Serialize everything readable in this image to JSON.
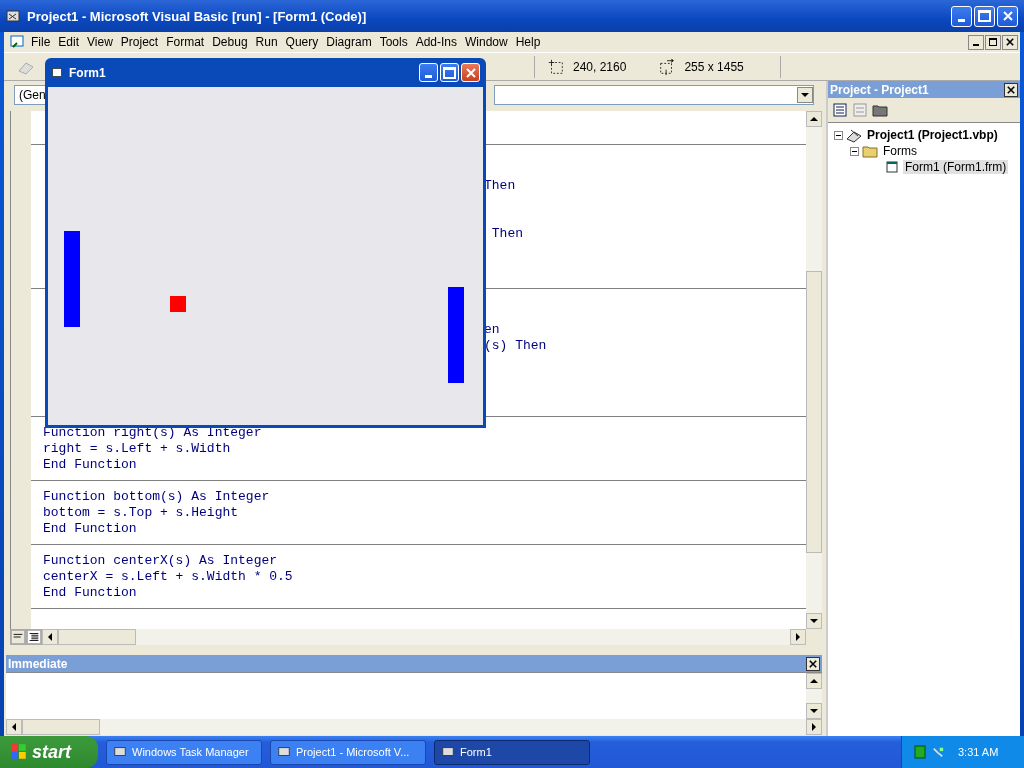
{
  "window": {
    "title": "Project1 - Microsoft Visual Basic [run] - [Form1 (Code)]"
  },
  "menu": [
    "File",
    "Edit",
    "View",
    "Project",
    "Format",
    "Debug",
    "Run",
    "Query",
    "Diagram",
    "Tools",
    "Add-Ins",
    "Window",
    "Help"
  ],
  "toolbar": {
    "position": "240, 2160",
    "size": "255 x 1455"
  },
  "code_window": {
    "object_combo": "(Gen",
    "blocks": [
      {
        "lines": [
          "Then",
          " Then"
        ]
      },
      {
        "lines": [
          "en",
          "(s) Then"
        ]
      },
      {
        "lines": [
          "Function right(s) As Integer",
          "right = s.Left + s.Width",
          "End Function"
        ]
      },
      {
        "lines": [
          "Function bottom(s) As Integer",
          "bottom = s.Top + s.Height",
          "End Function"
        ]
      },
      {
        "lines": [
          "Function centerX(s) As Integer",
          "centerX = s.Left + s.Width * 0.5",
          "End Function"
        ]
      }
    ]
  },
  "immediate": {
    "title": "Immediate"
  },
  "project_panel": {
    "title": "Project - Project1",
    "tree": [
      {
        "label": "Project1 (Project1.vbp)",
        "expanded": true,
        "selected": false,
        "children": [
          {
            "label": "Forms",
            "expanded": true,
            "selected": false,
            "children": [
              {
                "label": "Form1 (Form1.frm)",
                "selected": true
              }
            ]
          }
        ]
      }
    ]
  },
  "form": {
    "title": "Form1",
    "shapes": [
      {
        "kind": "paddle",
        "color": "#0000ff"
      },
      {
        "kind": "ball",
        "color": "#ff0000"
      },
      {
        "kind": "paddle",
        "color": "#0000ff"
      }
    ]
  },
  "taskbar": {
    "start": "start",
    "tasks": [
      {
        "label": "Windows Task Manager",
        "selected": false
      },
      {
        "label": "Project1 - Microsoft V...",
        "selected": false
      },
      {
        "label": "Form1",
        "selected": true
      }
    ],
    "clock": "3:31 AM"
  }
}
